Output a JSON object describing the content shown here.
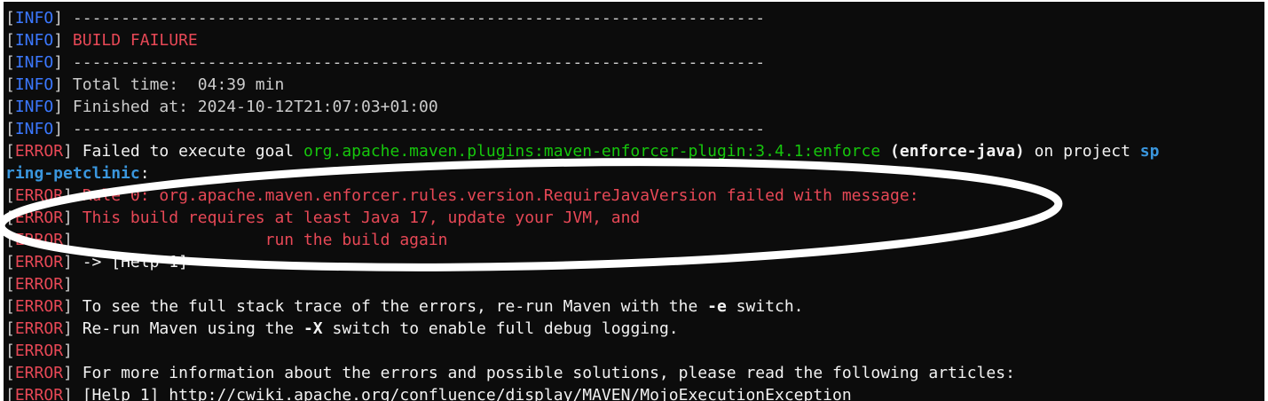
{
  "terminal": {
    "lines": [
      {
        "tag": "INFO",
        "text": "------------------------------------------------------------------------"
      },
      {
        "tag": "INFO",
        "text": "BUILD FAILURE"
      },
      {
        "tag": "INFO",
        "text": "------------------------------------------------------------------------"
      },
      {
        "tag": "INFO",
        "text": "Total time:  04:39 min"
      },
      {
        "tag": "INFO",
        "text": "Finished at: 2024-10-12T21:07:03+01:00"
      },
      {
        "tag": "INFO",
        "text": "------------------------------------------------------------------------"
      },
      {
        "tag": "ERROR",
        "parts": [
          "Failed to execute goal ",
          "org.apache.maven.plugins:maven-enforcer-plugin:3.4.1:enforce",
          " (enforce-java)",
          " on project ",
          "sp"
        ]
      },
      {
        "tag": "",
        "parts": [
          "ring-petclinic",
          ":"
        ]
      },
      {
        "tag": "ERROR",
        "text": "Rule 0: org.apache.maven.enforcer.rules.version.RequireJavaVersion failed with message:"
      },
      {
        "tag": "ERROR",
        "text": "This build requires at least Java 17, update your JVM, and"
      },
      {
        "tag": "ERROR",
        "text": "                   run the build again"
      },
      {
        "tag": "ERROR",
        "text": "-> [Help 1]"
      },
      {
        "tag": "ERROR",
        "text": ""
      },
      {
        "tag": "ERROR",
        "parts": [
          "To see the full stack trace of the errors, re-run Maven with the ",
          "-e",
          " switch."
        ]
      },
      {
        "tag": "ERROR",
        "parts": [
          "Re-run Maven using the ",
          "-X",
          " switch to enable full debug logging."
        ]
      },
      {
        "tag": "ERROR",
        "text": ""
      },
      {
        "tag": "ERROR",
        "text": "For more information about the errors and possible solutions, please read the following articles:"
      },
      {
        "tag": "ERROR",
        "text": "[Help 1] http://cwiki.apache.org/confluence/display/MAVEN/MojoExecutionException"
      }
    ]
  },
  "colors": {
    "background": "#0c0c0c",
    "info": "#3b78ff",
    "error": "#e74856",
    "plugin": "#16c60c",
    "project": "#3a96dd",
    "annotation": "#ffffff"
  },
  "annotation": {
    "shape": "ellipse",
    "color": "white"
  }
}
